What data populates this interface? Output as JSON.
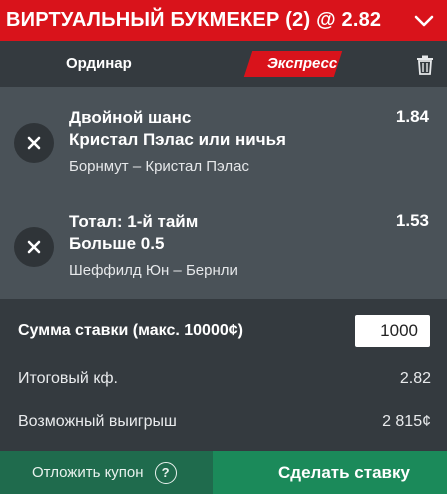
{
  "header": {
    "title": "ВИРТУАЛЬНЫЙ БУКМЕКЕР (2) @ 2.82",
    "toggle_icon": "chevron-down-icon"
  },
  "tabs": {
    "single_label": "Ординар",
    "express_label": "Экспресс",
    "active": "express",
    "delete_icon": "trash-icon"
  },
  "bets": [
    {
      "market_line1": "Двойной шанс",
      "market_line2": "Кристал Пэлас или ничья",
      "odds": "1.84",
      "event": "Борнмут – Кристал Пэлас",
      "remove_icon": "close-icon"
    },
    {
      "market_line1": "Тотал: 1-й тайм",
      "market_line2": "Больше 0.5",
      "odds": "1.53",
      "event": "Шеффилд Юн – Бернли",
      "remove_icon": "close-icon"
    }
  ],
  "summary": {
    "stake_label": "Сумма ставки (макс. 10000¢)",
    "stake_value": "1000",
    "total_odds_label": "Итоговый кф.",
    "total_odds_value": "2.82",
    "possible_win_label": "Возможный выигрыш",
    "possible_win_value": "2 815¢"
  },
  "footer": {
    "postpone_label": "Отложить купон",
    "help_symbol": "?",
    "place_bet_label": "Сделать ставку"
  },
  "colors": {
    "accent_red": "#d9131b",
    "panel_dark": "#343a3f",
    "bet_bg": "#4a5258",
    "green_dark": "#1f6b4d",
    "green_primary": "#1b8a5a"
  }
}
